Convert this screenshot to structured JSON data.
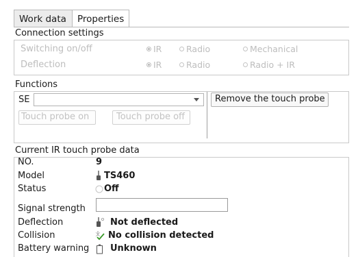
{
  "tabs": [
    {
      "label": "Work data",
      "active": true
    },
    {
      "label": "Properties",
      "active": false
    }
  ],
  "connection": {
    "title": "Connection settings",
    "rows": [
      {
        "label": "Switching on/off",
        "options": [
          "IR",
          "Radio",
          "Mechanical"
        ],
        "selected": "IR"
      },
      {
        "label": "Deflection",
        "options": [
          "IR",
          "Radio",
          "Radio + IR"
        ],
        "selected": "IR"
      }
    ]
  },
  "functions": {
    "title": "Functions",
    "se_label": "SE",
    "se_value": "",
    "remove_button": "Remove the touch probe",
    "probe_on_button": "Touch probe on",
    "probe_off_button": "Touch probe off"
  },
  "ir_data": {
    "title": "Current IR touch probe data",
    "no_label": "NO.",
    "no_value": "9",
    "model_label": "Model",
    "model_value": "TS460",
    "status_label": "Status",
    "status_value": "Off",
    "signal_label": "Signal strength",
    "signal_value": "",
    "deflection_label": "Deflection",
    "deflection_value": "Not deflected",
    "collision_label": "Collision",
    "collision_value": "No collision detected",
    "battery_label": "Battery warning",
    "battery_value": "Unknown"
  },
  "icons": {
    "model": "touch-probe-icon",
    "status": "status-circle-icon",
    "deflection": "deflection-icon",
    "collision": "collision-icon",
    "battery": "battery-icon"
  }
}
